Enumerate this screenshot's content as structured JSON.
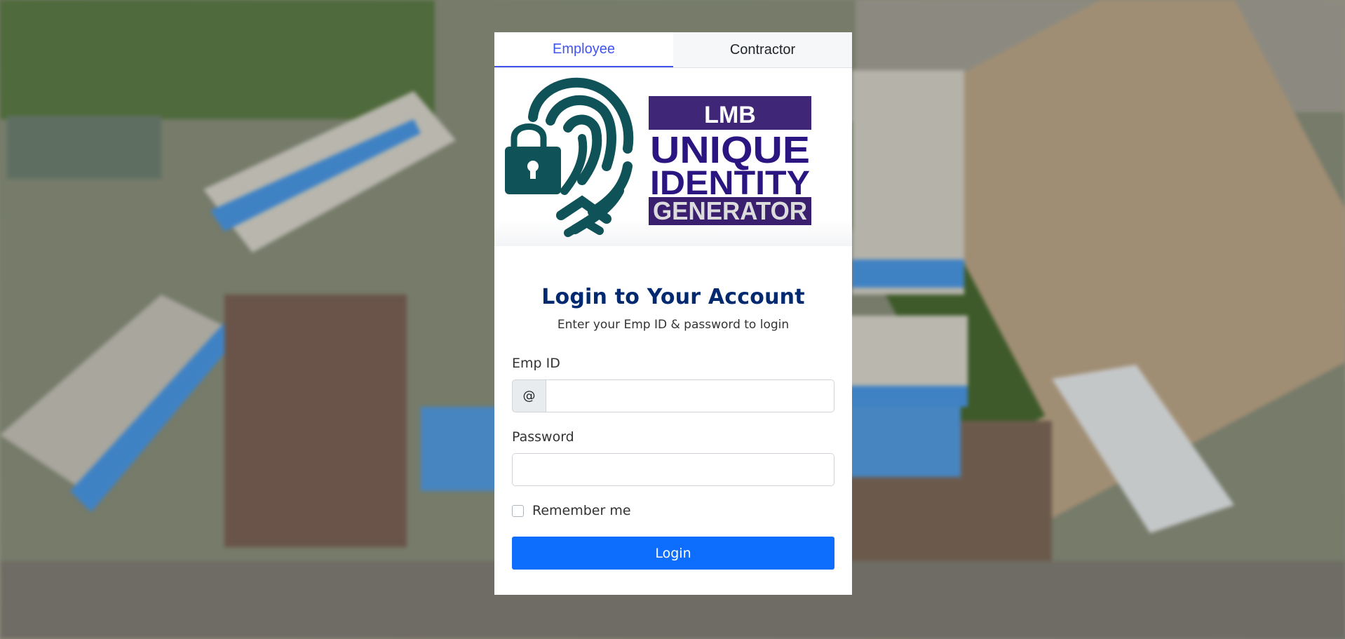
{
  "tabs": [
    {
      "label": "Employee",
      "active": true
    },
    {
      "label": "Contractor",
      "active": false
    }
  ],
  "logo": {
    "icon": "fingerprint-lock-icon",
    "line1": "LMB",
    "line2": "UNIQUE",
    "line3": "IDENTITY",
    "line4": "GENERATOR",
    "colors": {
      "fingerprint": "#0f5257",
      "box": "#3a1f6e",
      "banner": "#5b3a8c",
      "text_unique": "#2b1580",
      "generator_text": "#dcdcdc"
    }
  },
  "login": {
    "title": "Login to Your Account",
    "subtitle": "Enter your Emp ID & password to login",
    "emp_id_label": "Emp ID",
    "emp_id_prefix": "@",
    "emp_id_value": "",
    "password_label": "Password",
    "password_value": "",
    "remember_label": "Remember me",
    "remember_checked": false,
    "button_label": "Login"
  },
  "colors": {
    "accent": "#4154f1",
    "title": "#012970",
    "button": "#0d6efd"
  }
}
